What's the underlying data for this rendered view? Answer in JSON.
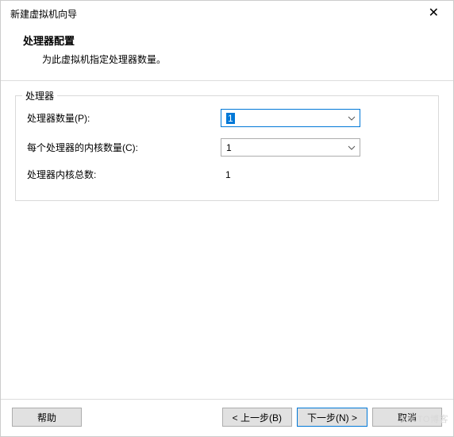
{
  "window": {
    "title": "新建虚拟机向导"
  },
  "header": {
    "title": "处理器配置",
    "subtitle": "为此虚拟机指定处理器数量。"
  },
  "group": {
    "legend": "处理器",
    "rows": {
      "procCount": {
        "label": "处理器数量(P):",
        "value": "1"
      },
      "coresPerProc": {
        "label": "每个处理器的内核数量(C):",
        "value": "1"
      },
      "totalCores": {
        "label": "处理器内核总数:",
        "value": "1"
      }
    }
  },
  "buttons": {
    "help": "帮助",
    "back": "< 上一步(B)",
    "next": "下一步(N) >",
    "cancel": "取消"
  },
  "watermark": "51CTO博客"
}
